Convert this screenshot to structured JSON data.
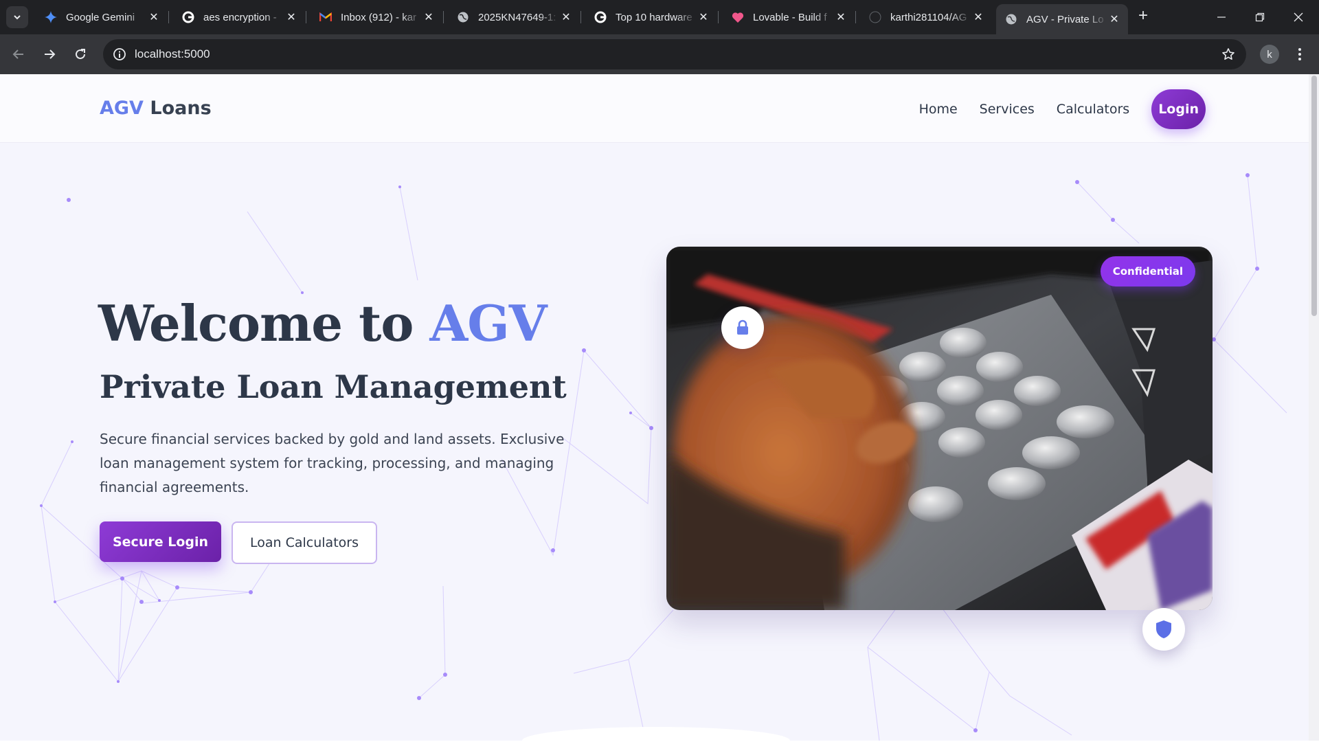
{
  "browser": {
    "tabs": [
      {
        "title": "Google Gemini",
        "icon": "gemini-icon"
      },
      {
        "title": "aes encryption -",
        "icon": "google-icon"
      },
      {
        "title": "Inbox (912) - kar",
        "icon": "gmail-icon"
      },
      {
        "title": "2025KN47649-1:",
        "icon": "globe-icon"
      },
      {
        "title": "Top 10 hardware",
        "icon": "google-icon"
      },
      {
        "title": "Lovable - Build f",
        "icon": "lovable-icon"
      },
      {
        "title": "karthi281104/AG",
        "icon": "github-icon"
      },
      {
        "title": "AGV - Private Lo",
        "icon": "globe-icon",
        "active": true
      }
    ],
    "url": "localhost:5000",
    "profile_initial": "k"
  },
  "site": {
    "logo_accent": "AGV",
    "logo_rest": " Loans",
    "nav": {
      "home": "Home",
      "services": "Services",
      "calculators": "Calculators",
      "login": "Login"
    }
  },
  "hero": {
    "title_prefix": "Welcome to ",
    "title_accent": "AGV",
    "subtitle": "Private Loan Management",
    "description": "Secure financial services backed by gold and land assets. Exclusive loan management system for tracking, processing, and managing financial agreements.",
    "primary_button": "Secure Login",
    "secondary_button": "Loan Calculators"
  },
  "card": {
    "badge": "Confidential",
    "top_icon": "lock-icon",
    "bottom_icon": "shield-icon",
    "image_subject": "atm-keypad-photo"
  },
  "colors": {
    "accent": "#667eea",
    "purple": "#7c3aed",
    "text_dark": "#2d3748"
  }
}
